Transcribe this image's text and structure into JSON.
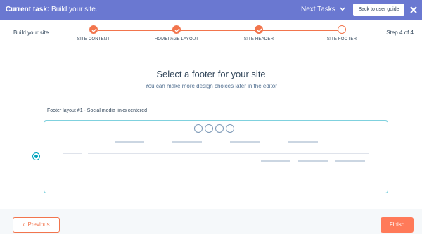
{
  "topbar": {
    "task_prefix": "Current task:",
    "task_name": "Build your site.",
    "next_tasks_label": "Next Tasks",
    "back_button_label": "Back to user guide",
    "background_color": "#6a78d1"
  },
  "progress": {
    "title": "Build your site",
    "step_indicator": "Step 4 of 4",
    "accent_color": "#f2754d",
    "steps": [
      {
        "label": "SITE CONTENT",
        "status": "complete"
      },
      {
        "label": "HOMEPAGE LAYOUT",
        "status": "complete"
      },
      {
        "label": "SITE HEADER",
        "status": "complete"
      },
      {
        "label": "SITE FOOTER",
        "status": "current"
      }
    ]
  },
  "main": {
    "heading": "Select a footer for your site",
    "subheading": "You can make more design choices later in the editor",
    "options": [
      {
        "caption": "Footer layout #1 - Social media links centered",
        "selected": true
      }
    ]
  },
  "footer": {
    "previous_label": "Previous",
    "finish_label": "Finish",
    "finish_color": "#ff7a59"
  }
}
